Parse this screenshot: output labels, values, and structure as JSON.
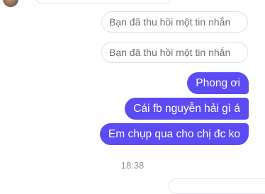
{
  "messages": {
    "recalled_1": "Bạn đã thu hồi một tin nhắn",
    "recalled_2": "Bạn đã thu hồi một tin nhắn",
    "outgoing": [
      "Phong ơi",
      "Cái fb nguyễn hải gì á",
      "Em chụp qua cho chị đc ko"
    ]
  },
  "timestamp": "18:38",
  "colors": {
    "outgoing_bubble": "#5b4bf5",
    "recalled_text": "#6b6f76",
    "timestamp_text": "#8e9197"
  }
}
